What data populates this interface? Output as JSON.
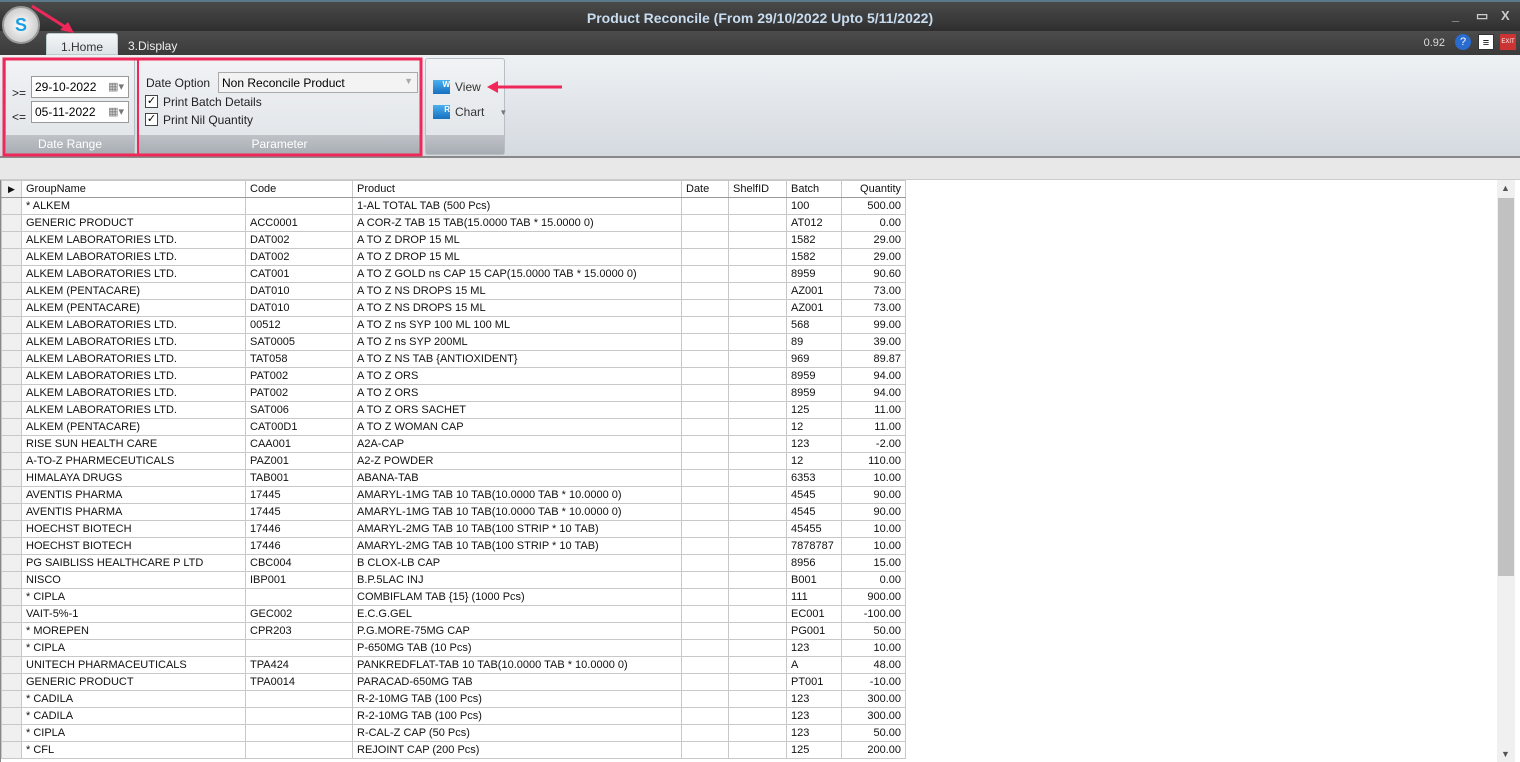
{
  "window": {
    "title": "Product Reconcile (From 29/10/2022 Upto 5/11/2022)",
    "logo_text": "S",
    "minimize": "_",
    "maximize": "▭",
    "close": "X"
  },
  "tabs": [
    {
      "label": "1.Home",
      "active": true
    },
    {
      "label": "3.Display",
      "active": false
    }
  ],
  "toolbar_right": {
    "version": "0.92",
    "icons": [
      "help-icon",
      "report-icon",
      "exit-icon"
    ],
    "exit_text": "EXIT"
  },
  "date_range": {
    "group_label": "Date Range",
    "from_op": ">=",
    "from": "29-10-2022",
    "to_op": "<=",
    "to": "05-11-2022"
  },
  "parameter": {
    "group_label": "Parameter",
    "date_option_label": "Date Option",
    "date_option_value": "Non Reconcile Product",
    "print_batch_details": {
      "label": "Print Batch Details",
      "checked": true
    },
    "print_nil_quantity": {
      "label": "Print Nil Quantity",
      "checked": true
    }
  },
  "actions": {
    "view": "View",
    "chart": "Chart"
  },
  "annotation_color": "#f0285a",
  "grid": {
    "columns": [
      "GroupName",
      "Code",
      "Product",
      "Date",
      "ShelfID",
      "Batch",
      "Quantity"
    ],
    "rows": [
      [
        "* ALKEM",
        "",
        "1-AL TOTAL TAB (500 Pcs)",
        "",
        "",
        "100",
        "500.00"
      ],
      [
        "GENERIC PRODUCT",
        "ACC0001",
        "A COR-Z TAB 15 TAB(15.0000 TAB * 15.0000 0)",
        "",
        "",
        "AT012",
        "0.00"
      ],
      [
        "ALKEM LABORATORIES LTD.",
        "DAT002",
        "A TO Z DROP 15 ML",
        "",
        "",
        "1582",
        "29.00"
      ],
      [
        "ALKEM LABORATORIES LTD.",
        "DAT002",
        "A TO Z DROP 15 ML",
        "",
        "",
        "1582",
        "29.00"
      ],
      [
        "ALKEM LABORATORIES LTD.",
        "CAT001",
        "A TO Z GOLD ns CAP 15 CAP(15.0000 TAB * 15.0000 0)",
        "",
        "",
        "8959",
        "90.60"
      ],
      [
        "ALKEM (PENTACARE)",
        "DAT010",
        "A TO Z NS DROPS 15 ML",
        "",
        "",
        "AZ001",
        "73.00"
      ],
      [
        "ALKEM (PENTACARE)",
        "DAT010",
        "A TO Z NS DROPS 15 ML",
        "",
        "",
        "AZ001",
        "73.00"
      ],
      [
        "ALKEM LABORATORIES LTD.",
        "00512",
        "A TO Z ns SYP 100 ML 100 ML",
        "",
        "",
        "568",
        "99.00"
      ],
      [
        "ALKEM LABORATORIES LTD.",
        "SAT0005",
        "A TO Z ns SYP 200ML",
        "",
        "",
        "89",
        "39.00"
      ],
      [
        "ALKEM LABORATORIES LTD.",
        "TAT058",
        "A TO Z NS TAB {ANTIOXIDENT}",
        "",
        "",
        "969",
        "89.87"
      ],
      [
        "ALKEM LABORATORIES LTD.",
        "PAT002",
        "A TO Z ORS",
        "",
        "",
        "8959",
        "94.00"
      ],
      [
        "ALKEM LABORATORIES LTD.",
        "PAT002",
        "A TO Z ORS",
        "",
        "",
        "8959",
        "94.00"
      ],
      [
        "ALKEM LABORATORIES LTD.",
        "SAT006",
        "A TO Z ORS SACHET",
        "",
        "",
        "125",
        "11.00"
      ],
      [
        "ALKEM (PENTACARE)",
        "CAT00D1",
        "A TO Z WOMAN CAP",
        "",
        "",
        "12",
        "11.00"
      ],
      [
        "RISE SUN HEALTH CARE",
        "CAA001",
        "A2A-CAP",
        "",
        "",
        "123",
        "-2.00"
      ],
      [
        "A-TO-Z PHARMECEUTICALS",
        "PAZ001",
        "A2-Z POWDER",
        "",
        "",
        "12",
        "110.00"
      ],
      [
        "HIMALAYA DRUGS",
        "TAB001",
        "ABANA-TAB",
        "",
        "",
        "6353",
        "10.00"
      ],
      [
        "AVENTIS PHARMA",
        "17445",
        "AMARYL-1MG TAB 10 TAB(10.0000 TAB * 10.0000 0)",
        "",
        "",
        "4545",
        "90.00"
      ],
      [
        "AVENTIS PHARMA",
        "17445",
        "AMARYL-1MG TAB 10 TAB(10.0000 TAB * 10.0000 0)",
        "",
        "",
        "4545",
        "90.00"
      ],
      [
        "HOECHST BIOTECH",
        "17446",
        "AMARYL-2MG TAB 10 TAB(100 STRIP * 10 TAB)",
        "",
        "",
        "45455",
        "10.00"
      ],
      [
        "HOECHST BIOTECH",
        "17446",
        "AMARYL-2MG TAB 10 TAB(100 STRIP * 10 TAB)",
        "",
        "",
        "7878787",
        "10.00"
      ],
      [
        "PG SAIBLISS HEALTHCARE P LTD",
        "CBC004",
        "B CLOX-LB CAP",
        "",
        "",
        "8956",
        "15.00"
      ],
      [
        "NISCO",
        "IBP001",
        "B.P.5LAC INJ",
        "",
        "",
        "B001",
        "0.00"
      ],
      [
        "* CIPLA",
        "",
        "COMBIFLAM TAB {15} (1000 Pcs)",
        "",
        "",
        "111",
        "900.00"
      ],
      [
        "VAIT-5%-1",
        "GEC002",
        "E.C.G.GEL",
        "",
        "",
        "EC001",
        "-100.00"
      ],
      [
        "* MOREPEN",
        "CPR203",
        "P.G.MORE-75MG CAP",
        "",
        "",
        "PG001",
        "50.00"
      ],
      [
        "* CIPLA",
        "",
        "P-650MG TAB (10 Pcs)",
        "",
        "",
        "123",
        "10.00"
      ],
      [
        "UNITECH PHARMACEUTICALS",
        "TPA424",
        "PANKREDFLAT-TAB 10 TAB(10.0000 TAB * 10.0000 0)",
        "",
        "",
        "A",
        "48.00"
      ],
      [
        "GENERIC PRODUCT",
        "TPA0014",
        "PARACAD-650MG TAB",
        "",
        "",
        "PT001",
        "-10.00"
      ],
      [
        "* CADILA",
        "",
        "R-2-10MG TAB (100 Pcs)",
        "",
        "",
        "123",
        "300.00"
      ],
      [
        "* CADILA",
        "",
        "R-2-10MG TAB (100 Pcs)",
        "",
        "",
        "123",
        "300.00"
      ],
      [
        "* CIPLA",
        "",
        "R-CAL-Z CAP (50 Pcs)",
        "",
        "",
        "123",
        "50.00"
      ],
      [
        "* CFL",
        "",
        "REJOINT CAP (200 Pcs)",
        "",
        "",
        "125",
        "200.00"
      ]
    ]
  }
}
